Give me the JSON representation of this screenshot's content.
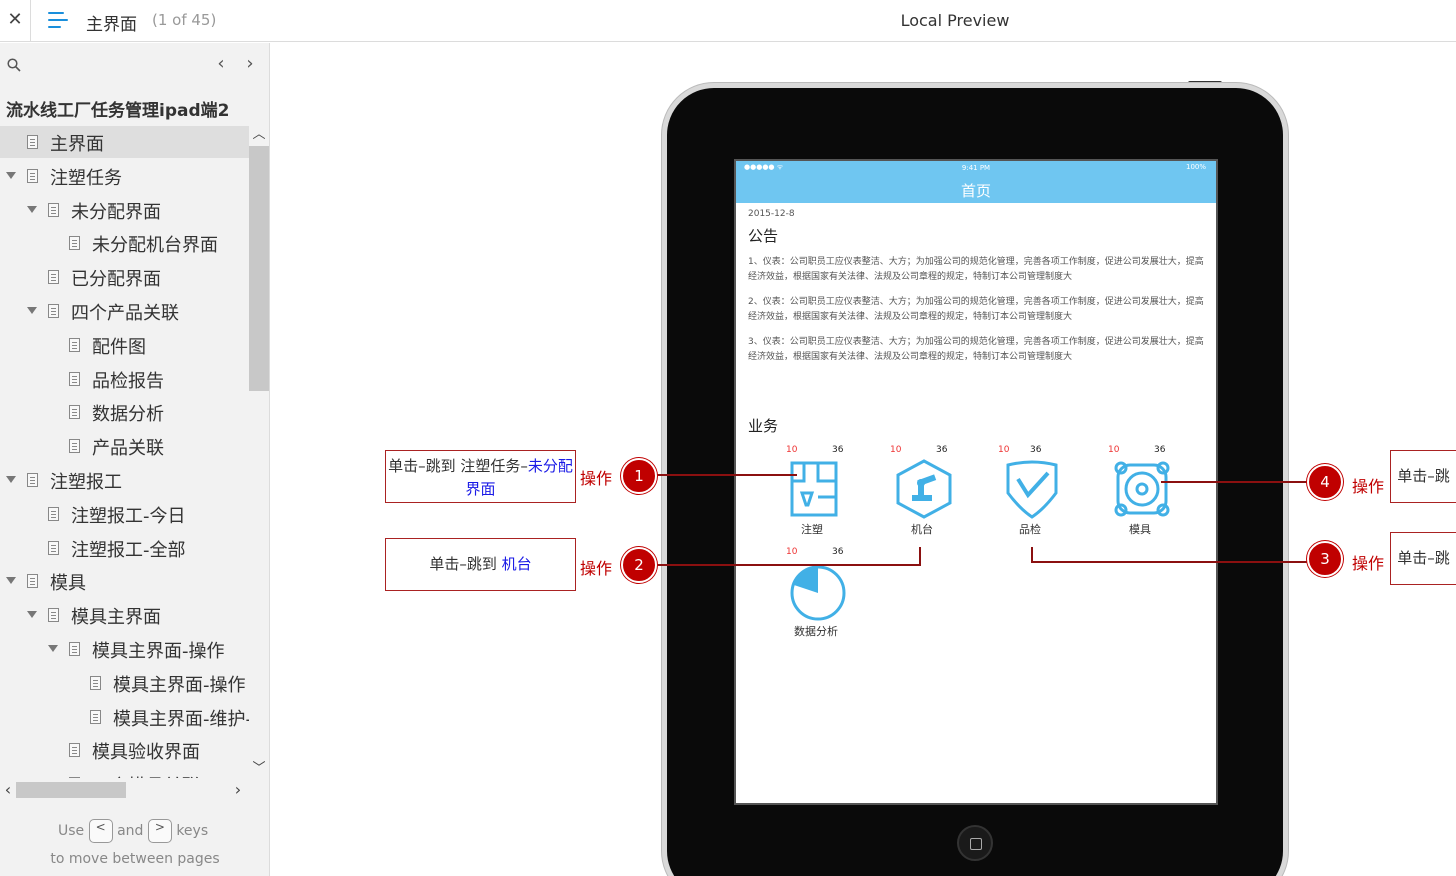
{
  "topbar": {
    "close_label": "✕",
    "page_title": "主界面",
    "page_count": "(1 of 45)",
    "preview_title": "Local Preview"
  },
  "sidebar": {
    "project_title": "流水线工厂任务管理ipad端2",
    "prev_label": "‹",
    "next_label": "›",
    "tree": [
      {
        "label": "主界面",
        "level": 0,
        "toggle": false,
        "selected": true
      },
      {
        "label": "注塑任务",
        "level": 0,
        "toggle": true
      },
      {
        "label": "未分配界面",
        "level": 1,
        "toggle": true
      },
      {
        "label": "未分配机台界面",
        "level": 2,
        "toggle": false
      },
      {
        "label": "已分配界面",
        "level": 1,
        "toggle": false
      },
      {
        "label": "四个产品关联",
        "level": 1,
        "toggle": true
      },
      {
        "label": "配件图",
        "level": 2,
        "toggle": false
      },
      {
        "label": "品检报告",
        "level": 2,
        "toggle": false
      },
      {
        "label": "数据分析",
        "level": 2,
        "toggle": false
      },
      {
        "label": "产品关联",
        "level": 2,
        "toggle": false
      },
      {
        "label": "注塑报工",
        "level": 0,
        "toggle": true
      },
      {
        "label": "注塑报工-今日",
        "level": 1,
        "toggle": false
      },
      {
        "label": "注塑报工-全部",
        "level": 1,
        "toggle": false
      },
      {
        "label": "模具",
        "level": 0,
        "toggle": true
      },
      {
        "label": "模具主界面",
        "level": 1,
        "toggle": true
      },
      {
        "label": "模具主界面-操作",
        "level": 2,
        "toggle": true
      },
      {
        "label": "模具主界面-操作",
        "level": 3,
        "toggle": false
      },
      {
        "label": "模具主界面-维护-:",
        "level": 3,
        "toggle": false
      },
      {
        "label": "模具验收界面",
        "level": 2,
        "toggle": false
      },
      {
        "label": "四个模具关联",
        "level": 2,
        "toggle": false
      }
    ],
    "hint": {
      "use": "Use",
      "and": "and",
      "keys": "keys",
      "line2": "to move between pages",
      "key_prev": "<",
      "key_next": ">"
    }
  },
  "screen": {
    "status_signal": "●●●●● ᯤ",
    "status_time": "9:41 PM",
    "status_battery": "100%",
    "nav_title": "首页",
    "date": "2015-12-8",
    "notice_heading": "公告",
    "notices": [
      "1、仪表：公司职员工应仪表整洁、大方；为加强公司的规范化管理，完善各项工作制度，促进公司发展壮大，提高经济效益，根据国家有关法律、法规及公司章程的规定，特制订本公司管理制度大",
      "2、仪表：公司职员工应仪表整洁、大方；为加强公司的规范化管理，完善各项工作制度，促进公司发展壮大，提高经济效益，根据国家有关法律、法规及公司章程的规定，特制订本公司管理制度大",
      "3、仪表：公司职员工应仪表整洁、大方；为加强公司的规范化管理，完善各项工作制度，促进公司发展壮大，提高经济效益，根据国家有关法律、法规及公司章程的规定，特制订本公司管理制度大"
    ],
    "biz_heading": "业务",
    "biz_items": [
      {
        "label": "注塑",
        "red": "10",
        "black": "36",
        "icon": "injection-molding-icon"
      },
      {
        "label": "机台",
        "red": "10",
        "black": "36",
        "icon": "robot-arm-icon"
      },
      {
        "label": "品检",
        "red": "10",
        "black": "36",
        "icon": "quality-shield-icon"
      },
      {
        "label": "模具",
        "red": "10",
        "black": "36",
        "icon": "mold-icon"
      },
      {
        "label": "数据分析",
        "red": "10",
        "black": "36",
        "icon": "pie-chart-icon"
      }
    ]
  },
  "annotations": {
    "op_label": "操作",
    "note1_prefix": "单击–跳到 注塑任务–",
    "note1_link": "未分配界面",
    "note2_prefix": "单击–跳到 ",
    "note2_link": "机台",
    "note3_text": "单击–跳",
    "note4_text": "单击–跳",
    "markers": [
      "1",
      "2",
      "3",
      "4"
    ]
  },
  "colors": {
    "accent": "#1a8fdc",
    "nav_blue": "#6fc6f1",
    "annotation_red": "#c00000"
  }
}
